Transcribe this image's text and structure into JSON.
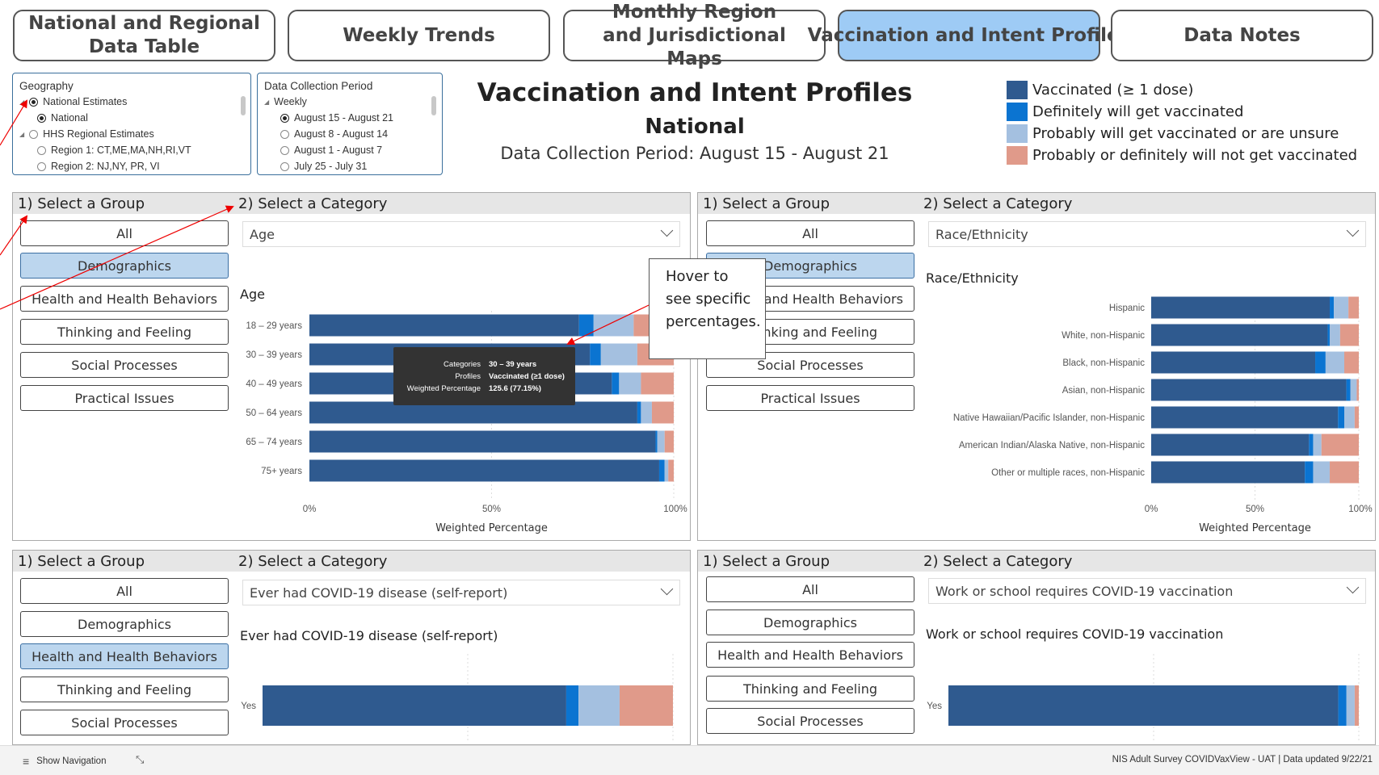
{
  "tabs": [
    {
      "label": "National and Regional Data Table"
    },
    {
      "label": "Weekly Trends"
    },
    {
      "label": "Monthly Region and Jurisdictional Maps"
    },
    {
      "label": "Vaccination and Intent Profiles"
    },
    {
      "label": "Data Notes"
    }
  ],
  "geography": {
    "header": "Geography",
    "items": [
      "National Estimates",
      "National",
      "HHS Regional Estimates",
      "Region 1: CT,ME,MA,NH,RI,VT",
      "Region 2: NJ,NY, PR, VI"
    ]
  },
  "period": {
    "header": "Data Collection Period",
    "items": [
      "Weekly",
      "August 15 - August 21",
      "August 8 - August 14",
      "August 1 - August 7",
      "July 25 - July 31"
    ]
  },
  "page": {
    "title": "Vaccination and Intent Profiles",
    "subtitle": "National",
    "period": "Data Collection Period: August 15  -  August 21"
  },
  "legend": {
    "items": [
      {
        "label": "Vaccinated  (≥ 1 dose)",
        "color": "#2f5a8f"
      },
      {
        "label": "Definitely will get vaccinated",
        "color": "#0b74d1"
      },
      {
        "label": "Probably will get vaccinated or are unsure",
        "color": "#a4c0e0"
      },
      {
        "label": "Probably or definitely will not get vaccinated",
        "color": "#e09a8a"
      }
    ]
  },
  "panel_labels": {
    "group": "1) Select a Group",
    "category": "2) Select a Category"
  },
  "groups": [
    "All",
    "Demographics",
    "Health and Health Behaviors",
    "Thinking and Feeling",
    "Social Processes",
    "Practical Issues"
  ],
  "panels": [
    {
      "category": "Age",
      "chart_title": "Age"
    },
    {
      "category": "Race/Ethnicity",
      "chart_title": "Race/Ethnicity"
    },
    {
      "category": "Ever had COVID-19 disease (self-report)",
      "chart_title": "Ever had COVID-19 disease (self-report)"
    },
    {
      "category": "Work or school requires COVID-19 vaccination",
      "chart_title": "Work or school requires COVID-19 vaccination"
    }
  ],
  "axis": {
    "ticks": [
      "0%",
      "50%",
      "100%"
    ],
    "label": "Weighted Percentage"
  },
  "tooltip": {
    "rows": [
      {
        "k": "Categories",
        "v": "30 – 39 years"
      },
      {
        "k": "Profiles",
        "v": "Vaccinated (≥1 dose)"
      },
      {
        "k": "Weighted Percentage",
        "v": "125.6 (77.15%)"
      }
    ]
  },
  "callout": {
    "text": "Hover to see specific percentages."
  },
  "footer": {
    "nav": "Show Navigation",
    "status": "NIS Adult Survey COVIDVaxView - UAT  |  Data updated 9/22/21"
  },
  "chart_data": [
    {
      "type": "bar",
      "orientation": "horizontal",
      "stacked": true,
      "title": "Age",
      "xlabel": "Weighted Percentage",
      "xlim": [
        0,
        100
      ],
      "categories": [
        "18 – 29 years",
        "30 – 39 years",
        "40 – 49 years",
        "50 – 64 years",
        "65 – 74 years",
        "75+ years"
      ],
      "series": [
        {
          "name": "Vaccinated  (≥ 1 dose)",
          "values": [
            74,
            77,
            83,
            90,
            95,
            96
          ]
        },
        {
          "name": "Definitely will get vaccinated",
          "values": [
            4,
            3,
            2,
            1,
            0.5,
            1.5
          ]
        },
        {
          "name": "Probably will get vaccinated or are unsure",
          "values": [
            11,
            10,
            6,
            3,
            2,
            1
          ]
        },
        {
          "name": "Probably or definitely will not get vaccinated",
          "values": [
            11,
            10,
            9,
            6,
            2.5,
            1.5
          ]
        }
      ]
    },
    {
      "type": "bar",
      "orientation": "horizontal",
      "stacked": true,
      "title": "Race/Ethnicity",
      "xlabel": "Weighted Percentage",
      "xlim": [
        0,
        100
      ],
      "categories": [
        "Hispanic",
        "White, non-Hispanic",
        "Black, non-Hispanic",
        "Asian, non-Hispanic",
        "Native Hawaiian/Pacific Islander, non-Hispanic",
        "American Indian/Alaska Native, non-Hispanic",
        "Other or multiple races, non-Hispanic"
      ],
      "series": [
        {
          "name": "Vaccinated  (≥ 1 dose)",
          "values": [
            86,
            85,
            79,
            94,
            90,
            76,
            74
          ]
        },
        {
          "name": "Definitely will get vaccinated",
          "values": [
            2,
            1,
            5,
            2,
            3,
            2,
            4
          ]
        },
        {
          "name": "Probably will get vaccinated or are unsure",
          "values": [
            7,
            5,
            9,
            3,
            5,
            4,
            8
          ]
        },
        {
          "name": "Probably or definitely will not get vaccinated",
          "values": [
            5,
            9,
            7,
            1,
            2,
            18,
            14
          ]
        }
      ]
    },
    {
      "type": "bar",
      "orientation": "horizontal",
      "stacked": true,
      "title": "Ever had COVID-19 disease (self-report)",
      "categories": [
        "Yes"
      ],
      "series": [
        {
          "name": "Vaccinated  (≥ 1 dose)",
          "values": [
            74
          ]
        },
        {
          "name": "Definitely will get vaccinated",
          "values": [
            3
          ]
        },
        {
          "name": "Probably will get vaccinated or are unsure",
          "values": [
            10
          ]
        },
        {
          "name": "Probably or definitely will not get vaccinated",
          "values": [
            13
          ]
        }
      ]
    },
    {
      "type": "bar",
      "orientation": "horizontal",
      "stacked": true,
      "title": "Work or school requires COVID-19 vaccination",
      "categories": [
        "Yes"
      ],
      "series": [
        {
          "name": "Vaccinated  (≥ 1 dose)",
          "values": [
            95
          ]
        },
        {
          "name": "Definitely will get vaccinated",
          "values": [
            2
          ]
        },
        {
          "name": "Probably will get vaccinated or are unsure",
          "values": [
            2
          ]
        },
        {
          "name": "Probably or definitely will not get vaccinated",
          "values": [
            1
          ]
        }
      ]
    }
  ]
}
